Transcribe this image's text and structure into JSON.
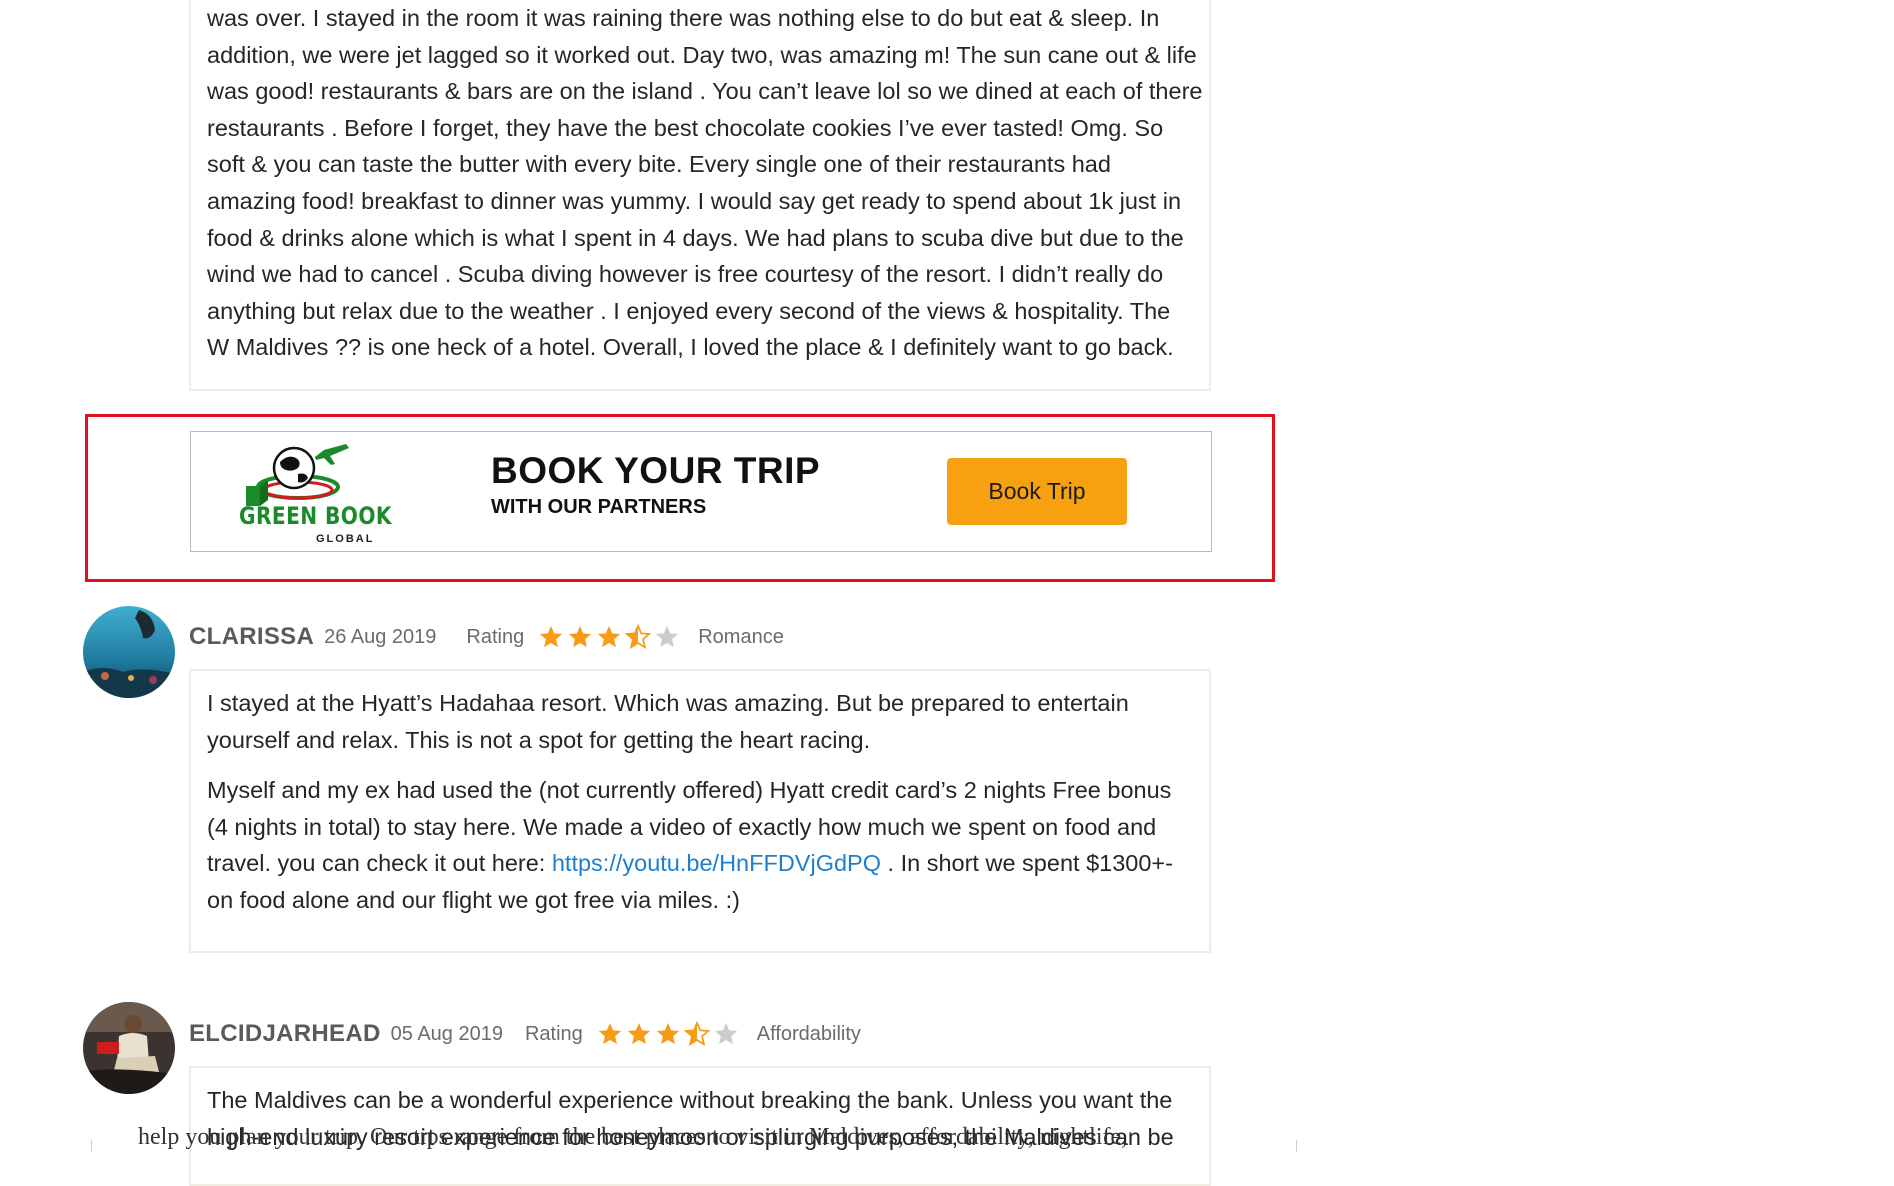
{
  "review_top": {
    "lines": [
      "was over. I stayed in the room it was raining there was nothing else to do but eat & sleep. In",
      "addition, we were jet lagged so it worked out. Day two, was amazing m! The sun cane out & life",
      "was good! restaurants & bars are on the island . You can’t leave lol so we dined at each of there",
      "restaurants . Before I forget, they have the best chocolate cookies I’ve ever tasted! Omg. So",
      "soft & you can taste the butter with every bite. Every single one of their restaurants had",
      "amazing food! breakfast to dinner was yummy. I would say get ready to spend about 1k just in",
      "food & drinks alone which is what I spent in 4 days. We had plans to scuba dive but due to the",
      "wind we had to cancel . Scuba diving however is free courtesy of the resort. I didn’t really do",
      "anything but relax due to the weather . I enjoyed every second of the views & hospitality. The",
      "W Maldives ?? is one heck of a hotel. Overall, I loved the place & I definitely want to go back."
    ]
  },
  "banner": {
    "logo_text": "GREEN BOOK",
    "logo_subtext": "GLOBAL",
    "title": "BOOK YOUR TRIP",
    "subtitle": "WITH OUR PARTNERS",
    "button_label": "Book Trip",
    "button_color": "#f8a110",
    "highlight_color": "#e0101c"
  },
  "reviews": [
    {
      "name": "CLARISSA",
      "date": "26 Aug 2019",
      "rating_label": "Rating",
      "rating": 3.5,
      "rating_max": 5,
      "tag": "Romance",
      "paragraph1": "I stayed at the Hyatt’s Hadahaa resort. Which was amazing. But be prepared to entertain yourself and relax. This is not a spot for getting the heart racing.",
      "paragraph2_before": "Myself and my ex had used the (not currently offered) Hyatt credit card’s 2 nights Free bonus (4 nights in total) to stay here. We made a video of exactly how much we spent on food and travel. you can check it out here: ",
      "link_text": "https://youtu.be/HnFFDVjGdPQ",
      "paragraph2_after": " . In short we spent $1300+- on food alone and our flight we got free via miles. :)"
    },
    {
      "name": "ELCIDJARHEAD",
      "date": "05 Aug 2019",
      "rating_label": "Rating",
      "rating": 3.5,
      "rating_max": 5,
      "tag": "Affordability",
      "paragraph1": "The Maldives can be a wonderful experience without breaking the bank. Unless you want the high-end luxury resort experience for honeymoon or splurging purposes, the Maldives can be"
    }
  ],
  "bottom_fragment": "help you plan your trip. Our tips range from the best places to visit in Maldives, affordability, nightlife,",
  "colors": {
    "star_filled": "#f59b16",
    "star_empty": "#cccccc",
    "link": "#1d7fd0",
    "name": "#5a5a5a"
  }
}
